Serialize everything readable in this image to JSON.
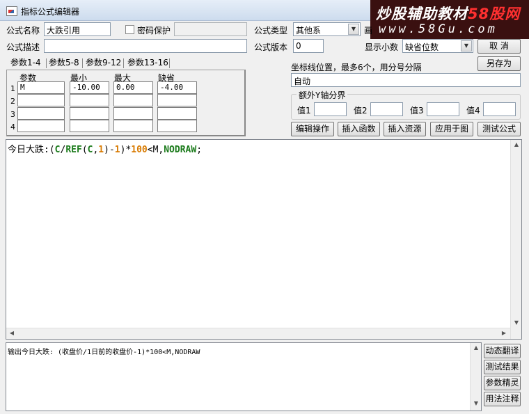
{
  "window": {
    "title": "指标公式编辑器"
  },
  "watermark": {
    "line1_a": "炒股辅助教材",
    "line1_b": "58股网",
    "line2": "www.58Gu.com"
  },
  "form": {
    "name_label": "公式名称",
    "name_value": "大跌引用",
    "password_label": "密码保护",
    "type_label": "公式类型",
    "type_value": "其他系",
    "draw_label_partial": "画",
    "desc_label": "公式描述",
    "desc_value": "",
    "version_label": "公式版本",
    "version_value": "0",
    "decimals_label": "显示小数",
    "decimals_value": "缺省位数",
    "cancel_label": "取  消",
    "saveas_label": "另存为"
  },
  "tabs": [
    "参数1-4",
    "参数5-8",
    "参数9-12",
    "参数13-16"
  ],
  "params": {
    "headers": [
      "参数",
      "最小",
      "最大",
      "缺省"
    ],
    "rows": [
      {
        "n": "1",
        "name": "M",
        "min": "-10.00",
        "max": "0.00",
        "def": "-4.00"
      },
      {
        "n": "2",
        "name": "",
        "min": "",
        "max": "",
        "def": ""
      },
      {
        "n": "3",
        "name": "",
        "min": "",
        "max": "",
        "def": ""
      },
      {
        "n": "4",
        "name": "",
        "min": "",
        "max": "",
        "def": ""
      }
    ]
  },
  "axis": {
    "label": "坐标线位置，最多6个，用分号分隔",
    "value": "自动",
    "extra_group": "额外Y轴分界",
    "values": [
      "值1",
      "值2",
      "值3",
      "值4"
    ]
  },
  "actions": [
    "编辑操作",
    "插入函数",
    "插入资源",
    "应用于图",
    "测试公式"
  ],
  "code": {
    "segments": [
      {
        "t": "今日大跌",
        "c": "#000000"
      },
      {
        "t": ":",
        "c": "#000000"
      },
      {
        "t": "(",
        "c": "#000000"
      },
      {
        "t": "C",
        "c": "#1a7a1a"
      },
      {
        "t": "/",
        "c": "#000000"
      },
      {
        "t": "REF",
        "c": "#1a7a1a"
      },
      {
        "t": "(",
        "c": "#000000"
      },
      {
        "t": "C",
        "c": "#1a7a1a"
      },
      {
        "t": ",",
        "c": "#000000"
      },
      {
        "t": "1",
        "c": "#d87a00"
      },
      {
        "t": ")",
        "c": "#000000"
      },
      {
        "t": "-",
        "c": "#000000"
      },
      {
        "t": "1",
        "c": "#d87a00"
      },
      {
        "t": ")",
        "c": "#000000"
      },
      {
        "t": "*",
        "c": "#000000"
      },
      {
        "t": "100",
        "c": "#d87a00"
      },
      {
        "t": "<M,",
        "c": "#000000"
      },
      {
        "t": "NODRAW",
        "c": "#1a7a1a"
      },
      {
        "t": ";",
        "c": "#000000"
      }
    ]
  },
  "translation": {
    "text": "输出今日大跌: (收盘价/1日前的收盘价-1)*100<M,NODRAW"
  },
  "side_buttons": [
    "动态翻译",
    "测试结果",
    "参数精灵",
    "用法注释"
  ]
}
